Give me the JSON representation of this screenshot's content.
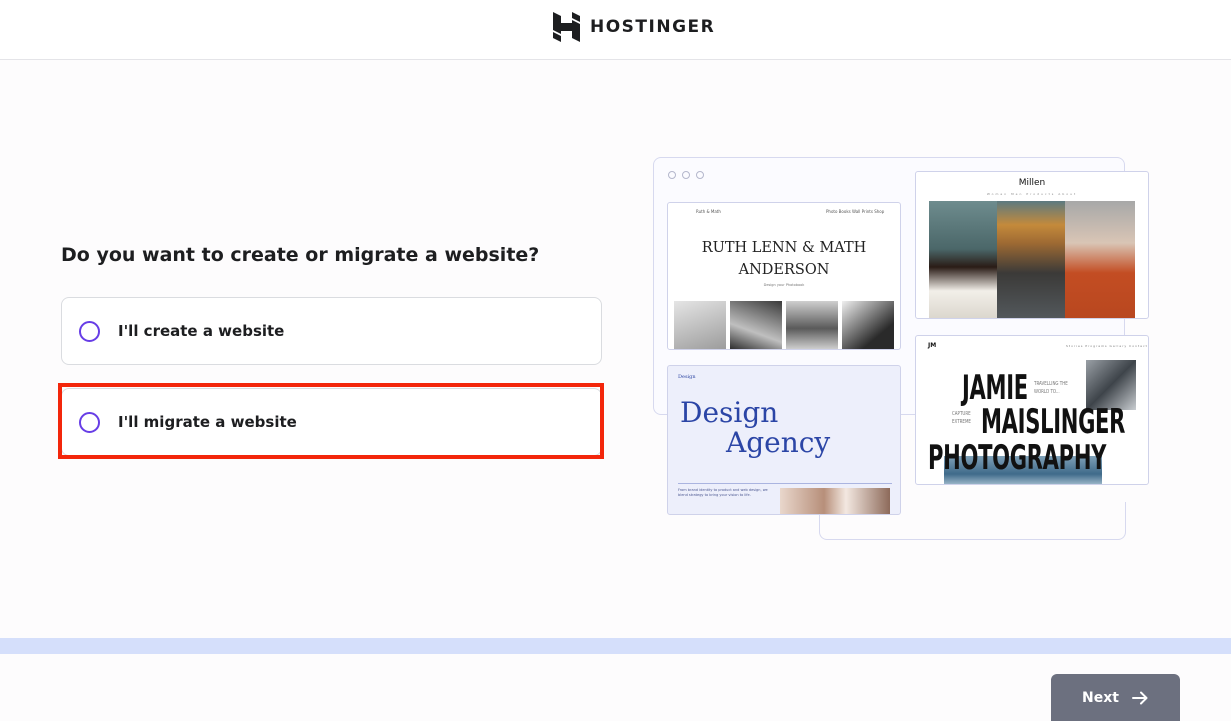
{
  "header": {
    "brand": "HOSTINGER"
  },
  "question": "Do you want to create or migrate a website?",
  "options": [
    {
      "label": "I'll create a website",
      "selected": false
    },
    {
      "label": "I'll migrate a website",
      "selected": false
    }
  ],
  "illustration": {
    "ruth_card": {
      "title_line1": "RUTH LENN & MATH",
      "title_line2": "ANDERSON",
      "brand": "Ruth & Math",
      "nav": "Photo Books   Wall Prints   Shop",
      "subtitle": "Design your Photobook"
    },
    "millen_card": {
      "title": "Millen",
      "nav": "Women  Men  Products  About"
    },
    "design_card": {
      "brand": "Design",
      "title_line1": "Design",
      "title_line2": "Agency",
      "copy": "From brand identity to product and web design, we blend strategy to bring your vision to life."
    },
    "jamie_card": {
      "logo": "JM",
      "nav": "Stories   Programs   Gallery   Contact",
      "name_line1": "JAMIE",
      "name_line2": "MAISLINGER",
      "name_line3": "PHOTOGRAPHY",
      "tagline1": "TRAVELLING THE",
      "tagline2": "WORLD TO...",
      "tagline3": "CAPTURE",
      "tagline4": "EXTREME"
    }
  },
  "progress": {
    "value_percent": 100
  },
  "footer": {
    "next_label": "Next"
  },
  "colors": {
    "accent": "#673de6",
    "highlight": "#f3260b",
    "button": "#6c707f",
    "progress": "#d5dffb"
  },
  "icons": {
    "radio": "radio-empty-icon",
    "next": "arrow-right-icon",
    "logo": "hostinger-logo-icon"
  }
}
